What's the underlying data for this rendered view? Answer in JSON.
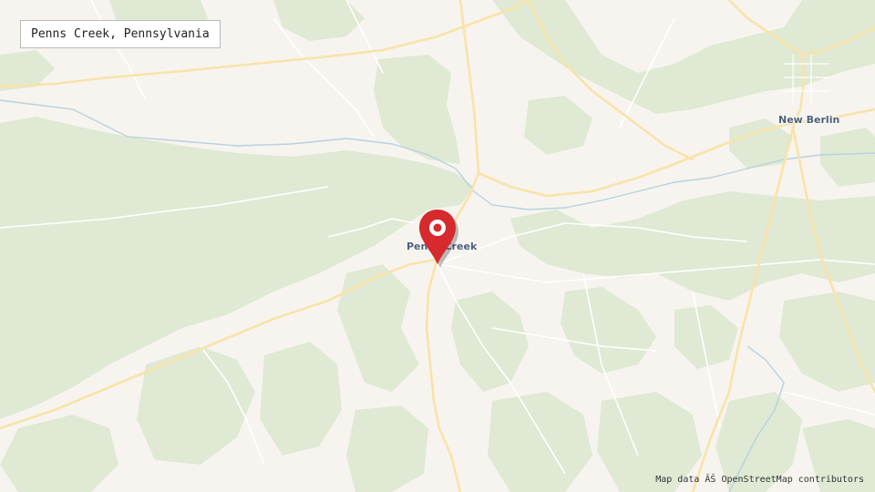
{
  "map_title": "Penns Creek, Pennsylvania",
  "labels": {
    "penns_creek": "Penns Creek",
    "new_berlin": "New Berlin"
  },
  "attribution": "Map data ÂŠ OpenStreetMap contributors",
  "colors": {
    "background": "#f7f4ef",
    "forest": "#dfe9d3",
    "forest_edge": "#cfdfc0",
    "road_major": "#f8e3a9",
    "road_minor": "#ffffff",
    "water": "#b7d2e0",
    "pin": "#d62a2e",
    "label": "#4c5f79"
  },
  "marker": {
    "icon": "map-pin-icon",
    "place": "Penns Creek"
  }
}
